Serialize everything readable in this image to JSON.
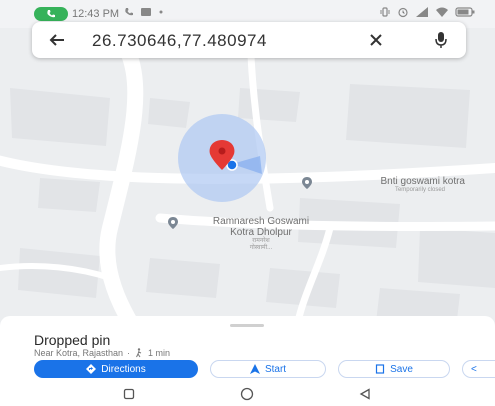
{
  "status_bar": {
    "time": "12:43 PM",
    "accent_call": "#36b25a",
    "icons_left": [
      "phone-icon",
      "message-icon",
      "dot-icon"
    ],
    "icons_right": [
      "vibrate-icon",
      "alarm-icon",
      "signal-icon",
      "wifi-icon",
      "battery-icon"
    ]
  },
  "search": {
    "query": "26.730646,77.480974",
    "icons": [
      "back-arrow-icon",
      "close-icon",
      "mic-icon"
    ]
  },
  "map": {
    "places": [
      {
        "name": "Bnti goswami kotra",
        "status": "Temporarily closed"
      },
      {
        "name_line1": "Ramnaresh Goswami",
        "name_line2": "Kotra Dholpur",
        "sub1": "रामनरेश",
        "sub2": "गोस्वामी..."
      }
    ],
    "accuracy_circle_color": "#aec7f2",
    "pin_color": "#e53935",
    "location_dot_color": "#1a73e8"
  },
  "sheet": {
    "title": "Dropped pin",
    "location": "Near Kotra, Rajasthan",
    "separator": "·",
    "walk_time": "1 min",
    "buttons": {
      "directions": "Directions",
      "start": "Start",
      "save": "Save",
      "share": "<"
    },
    "brand_color": "#1a73e8"
  },
  "nav": {
    "icons": [
      "recents-icon",
      "home-icon",
      "back-icon"
    ]
  }
}
